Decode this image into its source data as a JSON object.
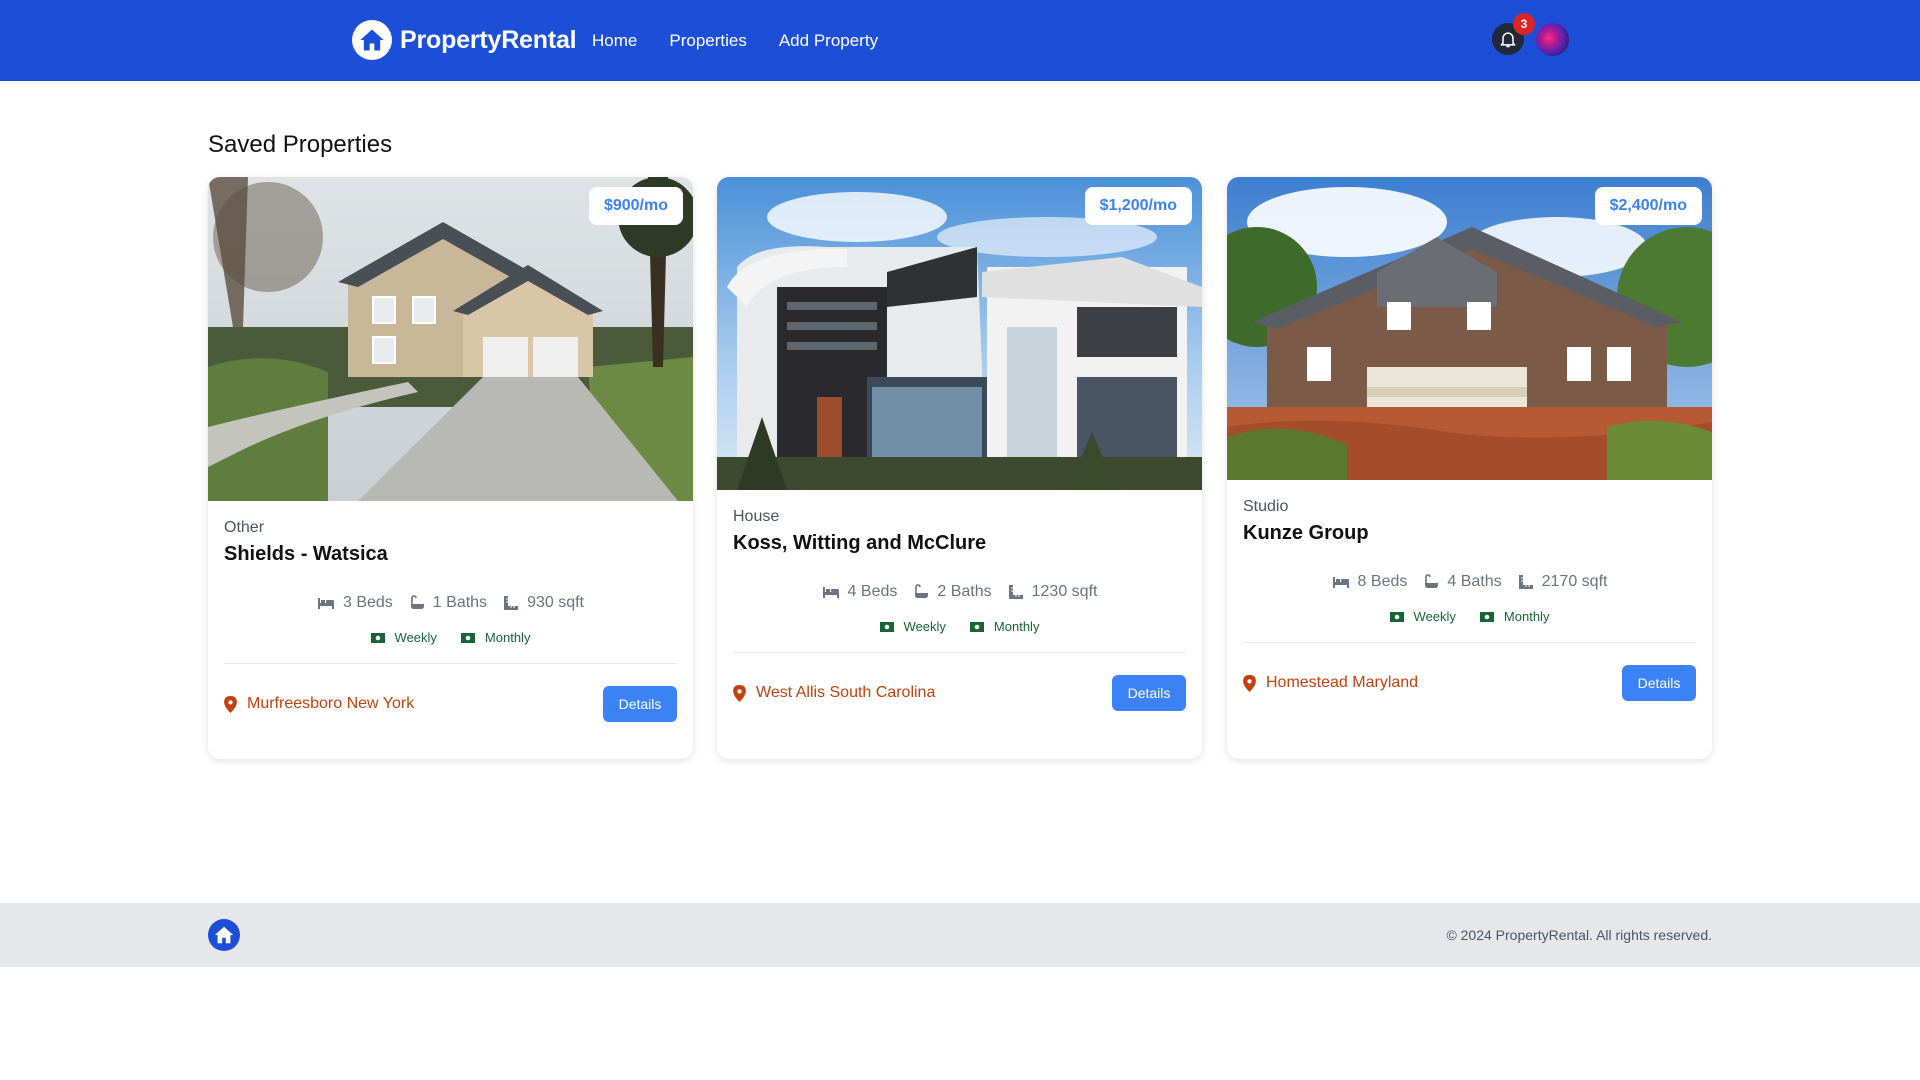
{
  "nav": {
    "brand": "PropertyRental",
    "links": [
      "Home",
      "Properties",
      "Add Property"
    ],
    "notification_count": "3"
  },
  "page": {
    "title": "Saved Properties"
  },
  "properties": [
    {
      "price": "$900/mo",
      "type": "Other",
      "name": "Shields - Watsica",
      "beds": "3 Beds",
      "baths": "1 Baths",
      "sqft": "930 sqft",
      "rates": [
        "Weekly",
        "Monthly"
      ],
      "location": "Murfreesboro New York",
      "details_label": "Details"
    },
    {
      "price": "$1,200/mo",
      "type": "House",
      "name": "Koss, Witting and McClure",
      "beds": "4 Beds",
      "baths": "2 Baths",
      "sqft": "1230 sqft",
      "rates": [
        "Weekly",
        "Monthly"
      ],
      "location": "West Allis South Carolina",
      "details_label": "Details"
    },
    {
      "price": "$2,400/mo",
      "type": "Studio",
      "name": "Kunze Group",
      "beds": "8 Beds",
      "baths": "4 Baths",
      "sqft": "2170 sqft",
      "rates": [
        "Weekly",
        "Monthly"
      ],
      "location": "Homestead Maryland",
      "details_label": "Details"
    }
  ],
  "footer": {
    "copyright": "© 2024 PropertyRental. All rights reserved."
  },
  "colors": {
    "primary": "#1d4ed8",
    "accent": "#3b82f6",
    "location": "#c2410c",
    "rate": "#166534"
  },
  "icons": [
    "home-icon",
    "bell-icon",
    "bed-icon",
    "bath-icon",
    "ruler-icon",
    "money-icon",
    "map-pin-icon"
  ]
}
